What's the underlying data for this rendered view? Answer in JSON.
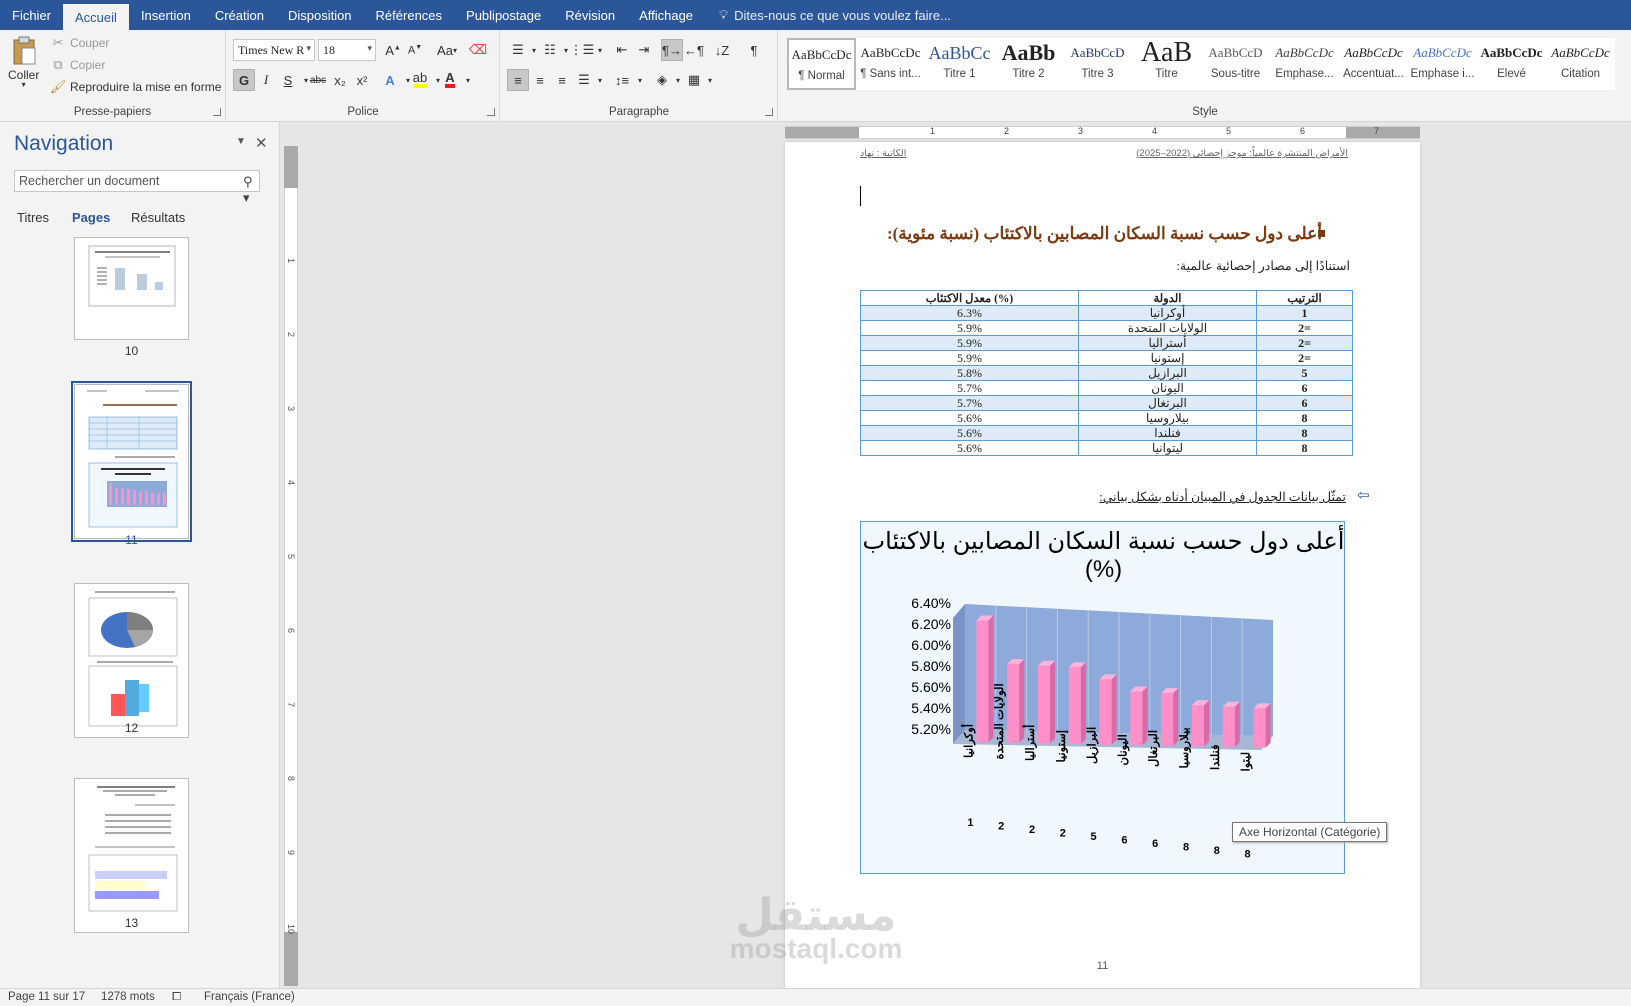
{
  "menu": {
    "tabs": [
      "Fichier",
      "Accueil",
      "Insertion",
      "Création",
      "Disposition",
      "Références",
      "Publipostage",
      "Révision",
      "Affichage"
    ],
    "active_tab": "Accueil",
    "tell_me": "Dites-nous ce que vous voulez faire..."
  },
  "ribbon": {
    "clipboard": {
      "label": "Presse-papiers",
      "paste": "Coller",
      "cut": "Couper",
      "copy": "Copier",
      "format_painter": "Reproduire la mise en forme"
    },
    "font": {
      "label": "Police",
      "font_name": "Times New R",
      "font_size": "18",
      "bold": "G",
      "italic": "I",
      "underline": "S",
      "strikethrough": "abc",
      "subscript": "x₂",
      "superscript": "x²",
      "case": "Aa"
    },
    "paragraph": {
      "label": "Paragraphe"
    },
    "styles": {
      "label": "Style",
      "items": [
        {
          "preview": "AaBbCcDc",
          "name": "¶ Normal"
        },
        {
          "preview": "AaBbCcDc",
          "name": "¶ Sans int..."
        },
        {
          "preview": "AaBbCc",
          "name": "Titre 1"
        },
        {
          "preview": "AaBb",
          "name": "Titre 2"
        },
        {
          "preview": "AaBbCcD",
          "name": "Titre 3"
        },
        {
          "preview": "AaB",
          "name": "Titre"
        },
        {
          "preview": "AaBbCcD",
          "name": "Sous-titre"
        },
        {
          "preview": "AaBbCcDc",
          "name": "Emphase..."
        },
        {
          "preview": "AaBbCcDc",
          "name": "Accentuat..."
        },
        {
          "preview": "AaBbCcDc",
          "name": "Emphase i..."
        },
        {
          "preview": "AaBbCcDc",
          "name": "Élevé"
        },
        {
          "preview": "AaBbCcDc",
          "name": "Citation"
        }
      ]
    }
  },
  "navigation": {
    "title": "Navigation",
    "search_placeholder": "Rechercher un document",
    "tabs": [
      "Titres",
      "Pages",
      "Résultats"
    ],
    "active_tab": "Pages",
    "pages": [
      "10",
      "11",
      "12",
      "13"
    ],
    "selected_page": "11"
  },
  "document": {
    "header_right": "الأمراض المنتشرة عالمياً: موجز إحصائي (2022–2025)",
    "header_left": "الكاتبة : نهاد",
    "heading": "أعلى دول حسب نسبة السكان المصابين بالاكتئاب (نسبة مئوية):",
    "intro": "استنادًا إلى مصادر إحصائية عالمية:",
    "table": {
      "headers": [
        "الترتيب",
        "الدولة",
        "(%) معدل الاكتئاب"
      ],
      "rows": [
        [
          "1",
          "أوكرانيا",
          "6.3%"
        ],
        [
          "=2",
          "الولايات المتحدة",
          "5.9%"
        ],
        [
          "=2",
          "أستراليا",
          "5.9%"
        ],
        [
          "=2",
          "إستونيا",
          "5.9%"
        ],
        [
          "5",
          "البرازيل",
          "5.8%"
        ],
        [
          "6",
          "اليونان",
          "5.7%"
        ],
        [
          "6",
          "البرتغال",
          "5.7%"
        ],
        [
          "8",
          "بيلاروسيا",
          "5.6%"
        ],
        [
          "8",
          "فنلندا",
          "5.6%"
        ],
        [
          "8",
          "ليتوانيا",
          "5.6%"
        ]
      ]
    },
    "note": "تمثّل بيانات الجدول في المبيان أدناه بشكل بياني:",
    "page_number": "11",
    "tooltip": "Axe Horizontal (Catégorie)"
  },
  "chart_data": {
    "type": "bar",
    "title": "أعلى دول حسب نسبة السكان المصابين بالاكتئاب (%)",
    "categories": [
      "أوكرانيا",
      "الولايات المتحدة",
      "أستراليا",
      "إستونيا",
      "البرازيل",
      "اليونان",
      "البرتغال",
      "بيلاروسيا",
      "فنلندا",
      "ليتوا"
    ],
    "ranks": [
      "1",
      "2",
      "2",
      "2",
      "5",
      "6",
      "6",
      "8",
      "8",
      "8"
    ],
    "values": [
      6.3,
      5.9,
      5.9,
      5.9,
      5.8,
      5.7,
      5.7,
      5.6,
      5.6,
      5.6
    ],
    "yticks": [
      "6.40%",
      "6.20%",
      "6.00%",
      "5.80%",
      "5.60%",
      "5.40%",
      "5.20%"
    ],
    "ylim": [
      5.2,
      6.4
    ],
    "bar_color": "#ff8fc8",
    "wall_color": "#8eaadb",
    "legend": "none",
    "grid": true
  },
  "statusbar": {
    "page": "Page 11 sur 17",
    "words": "1278 mots",
    "language": "Français (France)"
  },
  "watermark": {
    "arabic": "مستقل",
    "latin": "mostaql.com"
  },
  "colors": {
    "accent": "#2b579a",
    "heading": "#7a3b12",
    "table_border": "#5b9bd5",
    "table_alt": "#deeaf6"
  }
}
